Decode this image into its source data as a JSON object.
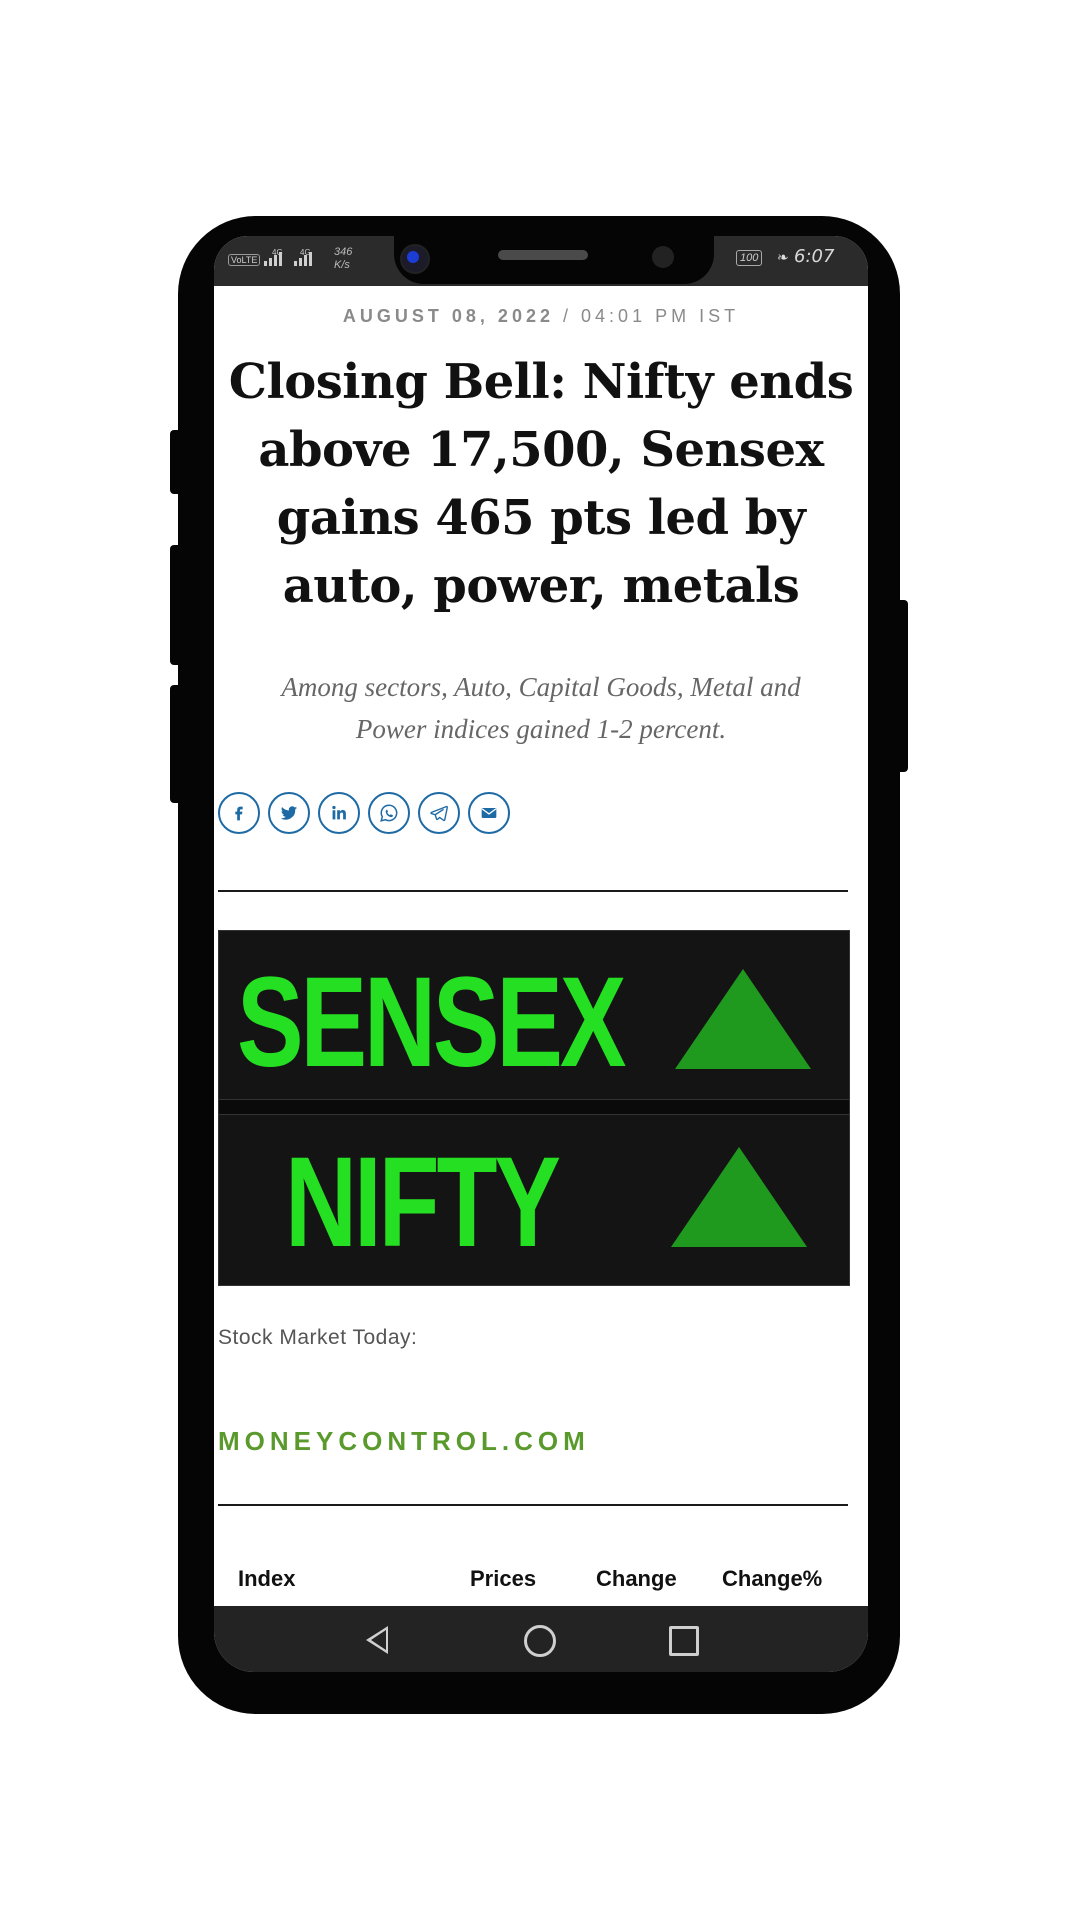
{
  "status_bar": {
    "volte": "VoLTE",
    "net_label_1": "4G",
    "net_label_2": "4G",
    "speed_value": "346",
    "speed_unit": "K/s",
    "battery": "100",
    "time": "6:07"
  },
  "article": {
    "date": "AUGUST 08, 2022",
    "separator": "/",
    "time": "04:01 PM IST",
    "headline": "Closing Bell: Nifty ends above 17,500, Sensex gains 465 pts led by auto, power, metals",
    "subheadline": "Among sectors, Auto, Capital Goods, Metal and Power indices gained 1-2 percent."
  },
  "share": {
    "icons": [
      "facebook-icon",
      "twitter-icon",
      "linkedin-icon",
      "whatsapp-icon",
      "telegram-icon",
      "email-icon"
    ],
    "color": "#1d6aa5"
  },
  "hero_image": {
    "line1": "SENSEX",
    "line2": "NIFTY",
    "text_color": "#25e022",
    "arrow_color": "#1f9a1f"
  },
  "caption": "Stock Market Today:",
  "brand": "MONEYCONTROL.COM",
  "brand_color": "#5a9a2c",
  "table": {
    "headers": [
      "Index",
      "Prices",
      "Change",
      "Change%"
    ]
  },
  "nav_bar": {
    "icons": [
      "back-icon",
      "home-icon",
      "recent-apps-icon"
    ]
  }
}
